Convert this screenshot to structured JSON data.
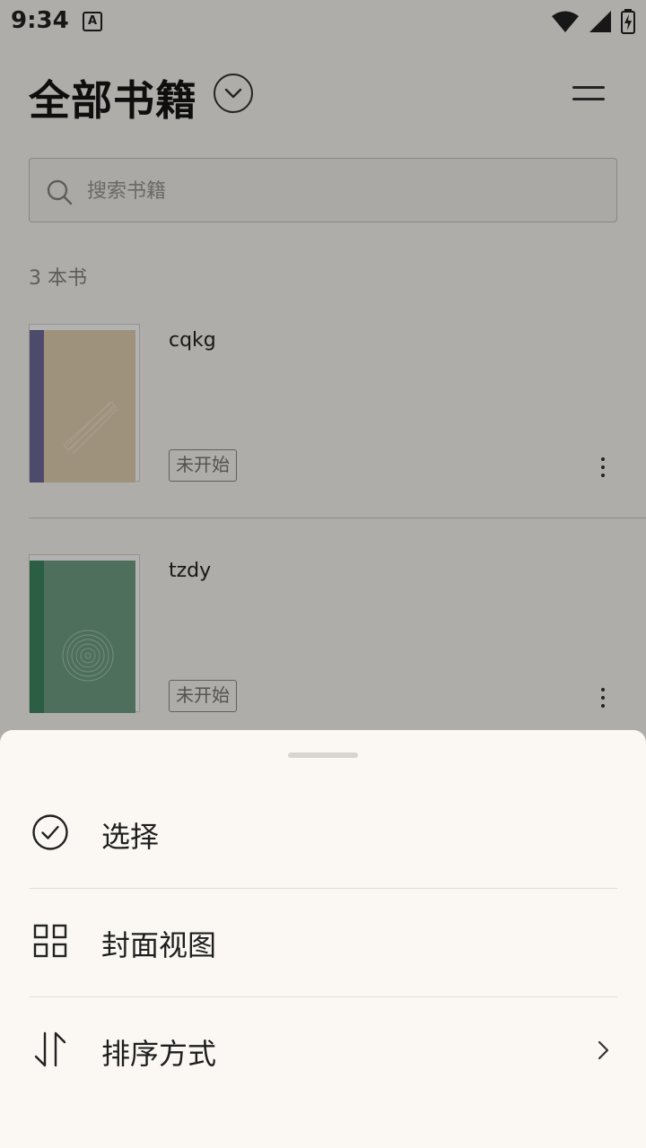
{
  "status_bar": {
    "time": "9:34",
    "app_icon_letter": "A"
  },
  "header": {
    "title": "全部书籍"
  },
  "search": {
    "placeholder": "搜索书籍"
  },
  "library": {
    "count_label": "3 本书",
    "books": [
      {
        "title": "cqkg",
        "status": "未开始",
        "cover_color": "#e3d1b2",
        "spine_color": "#6f6a9a"
      },
      {
        "title": "tzdy",
        "status": "未开始",
        "cover_color": "#6f9f85",
        "spine_color": "#3e8760"
      }
    ]
  },
  "sheet": {
    "items": [
      {
        "label": "选择",
        "icon": "check-circle-icon"
      },
      {
        "label": "封面视图",
        "icon": "grid-icon"
      },
      {
        "label": "排序方式",
        "icon": "sort-icon"
      }
    ]
  },
  "colors": {
    "background": "#fbf8f3",
    "scrim": "rgba(0,0,0,0.30)"
  }
}
